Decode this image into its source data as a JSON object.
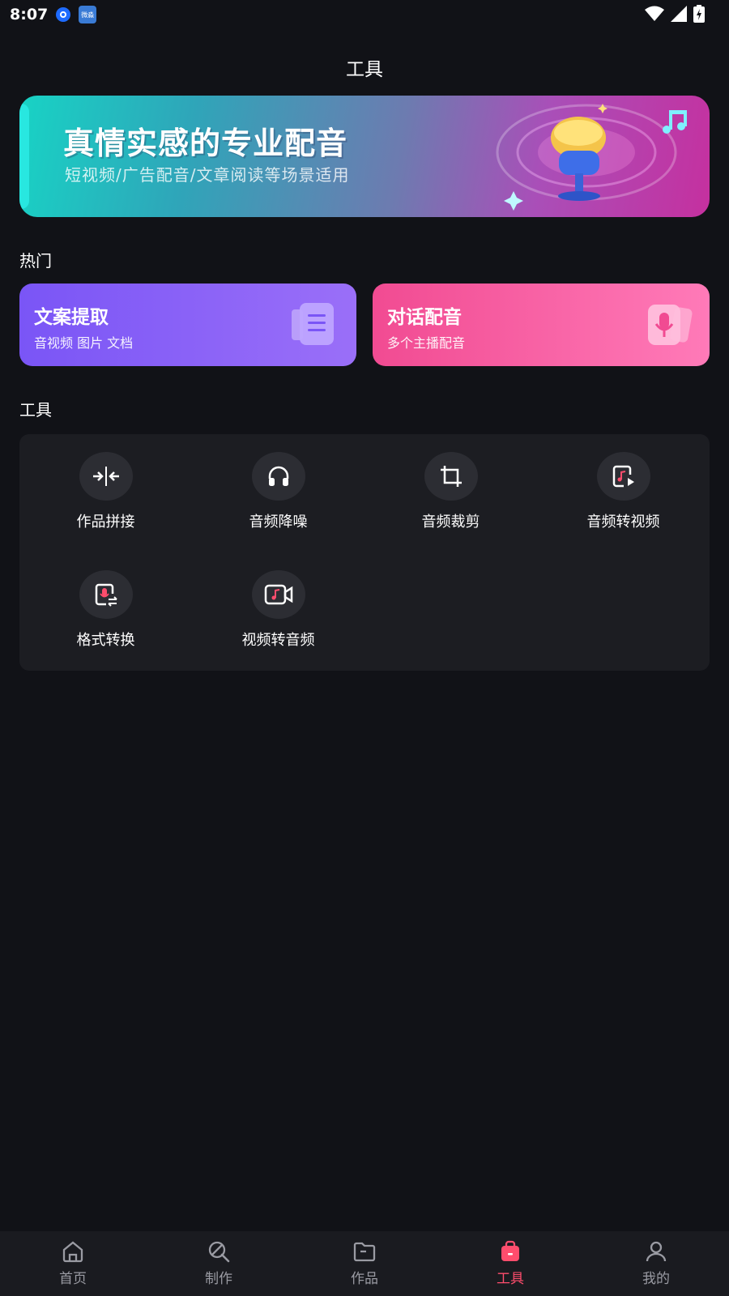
{
  "status_bar": {
    "time": "8:07",
    "app_icon_2_text": "微淼"
  },
  "header": {
    "title": "工具"
  },
  "banner": {
    "title": "真情实感的专业配音",
    "subtitle": "短视频/广告配音/文章阅读等场景适用"
  },
  "hot": {
    "section_label": "热门",
    "cards": [
      {
        "title": "文案提取",
        "subtitle": "音视频 图片 文档",
        "icon": "document-icon"
      },
      {
        "title": "对话配音",
        "subtitle": "多个主播配音",
        "icon": "microphone-icon"
      }
    ]
  },
  "tools": {
    "section_label": "工具",
    "items": [
      {
        "label": "作品拼接",
        "icon": "merge-icon"
      },
      {
        "label": "音频降噪",
        "icon": "headphones-icon"
      },
      {
        "label": "音频裁剪",
        "icon": "crop-icon"
      },
      {
        "label": "音频转视频",
        "icon": "audio-to-video-icon"
      },
      {
        "label": "格式转换",
        "icon": "format-convert-icon"
      },
      {
        "label": "视频转音频",
        "icon": "video-to-audio-icon"
      }
    ]
  },
  "bottom_nav": {
    "items": [
      {
        "label": "首页",
        "icon": "home-icon",
        "active": false
      },
      {
        "label": "制作",
        "icon": "create-icon",
        "active": false
      },
      {
        "label": "作品",
        "icon": "folder-icon",
        "active": false
      },
      {
        "label": "工具",
        "icon": "toolbag-icon",
        "active": true
      },
      {
        "label": "我的",
        "icon": "profile-icon",
        "active": false
      }
    ]
  },
  "colors": {
    "background": "#111217",
    "panel": "#1c1d22",
    "active": "#ff4d6d",
    "inactive": "#9a9ba3",
    "hot_card_left": "#7a55f6",
    "hot_card_right": "#f14b92"
  }
}
